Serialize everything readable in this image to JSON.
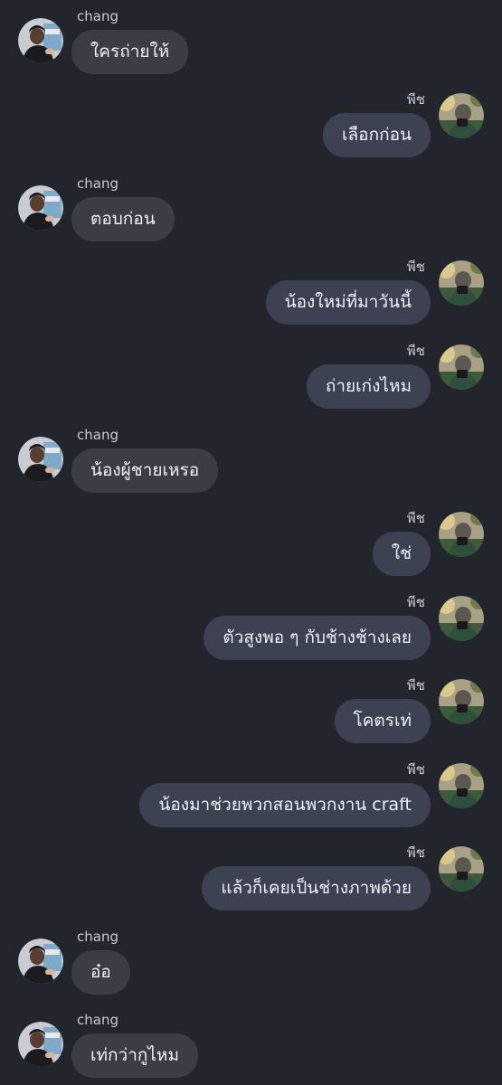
{
  "chat": {
    "messages": [
      {
        "sender": "chang",
        "side": "in",
        "text": "ใครถ่ายให้"
      },
      {
        "sender": "พีช",
        "side": "out",
        "text": "เลือกก่อน"
      },
      {
        "sender": "chang",
        "side": "in",
        "text": "ตอบก่อน"
      },
      {
        "sender": "พีช",
        "side": "out",
        "text": "น้องใหม่ที่มาวันนี้"
      },
      {
        "sender": "พีช",
        "side": "out",
        "text": "ถ่ายเก่งไหม"
      },
      {
        "sender": "chang",
        "side": "in",
        "text": "น้องผู้ชายเหรอ"
      },
      {
        "sender": "พีช",
        "side": "out",
        "text": "ใช่"
      },
      {
        "sender": "พีช",
        "side": "out",
        "text": "ตัวสูงพอ ๆ กับช้างช้างเลย"
      },
      {
        "sender": "พีช",
        "side": "out",
        "text": "โคตรเท่"
      },
      {
        "sender": "พีช",
        "side": "out",
        "text": "น้องมาช่วยพวกสอนพวกงาน craft"
      },
      {
        "sender": "พีช",
        "side": "out",
        "text": "แล้วก็เคยเป็นช่างภาพด้วย"
      },
      {
        "sender": "chang",
        "side": "in",
        "text": "อ๋อ"
      },
      {
        "sender": "chang",
        "side": "in",
        "text": "เท่กว่ากูไหม"
      }
    ]
  },
  "colors": {
    "background": "#22252c",
    "incoming_bubble": "#3b3d45",
    "outgoing_bubble": "#3c4252",
    "name_text": "#c9cbd0"
  },
  "icons": {
    "incoming_avatar": "avatar-chang-icon",
    "outgoing_avatar": "avatar-peach-icon"
  }
}
